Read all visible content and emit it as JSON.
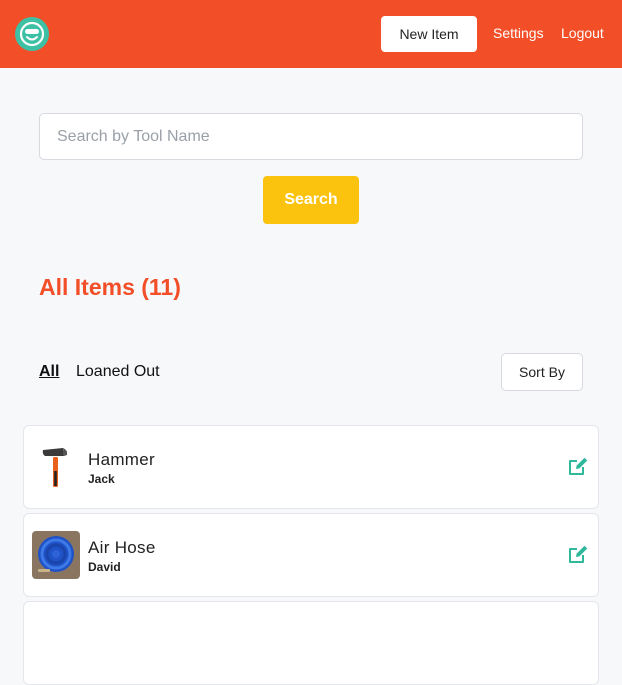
{
  "header": {
    "logo_icon": "smiley-mask-icon",
    "new_item_label": "New Item",
    "settings_label": "Settings",
    "logout_label": "Logout"
  },
  "search": {
    "placeholder": "Search by Tool Name",
    "value": "",
    "button_label": "Search"
  },
  "main": {
    "title": "All Items (11)",
    "tabs": [
      {
        "label": "All",
        "active": true
      },
      {
        "label": "Loaned Out",
        "active": false
      }
    ],
    "sort_label": "Sort By"
  },
  "items": [
    {
      "name": "Hammer",
      "owner": "Jack",
      "thumb_icon": "hammer-icon",
      "edit_icon": "edit-icon"
    },
    {
      "name": "Air Hose",
      "owner": "David",
      "thumb_icon": "air-hose-icon",
      "edit_icon": "edit-icon"
    }
  ],
  "colors": {
    "brand": "#f24e27",
    "search_button": "#fcc30e",
    "logo": "#3ec0a4",
    "edit_icon": "#2fb89a"
  }
}
